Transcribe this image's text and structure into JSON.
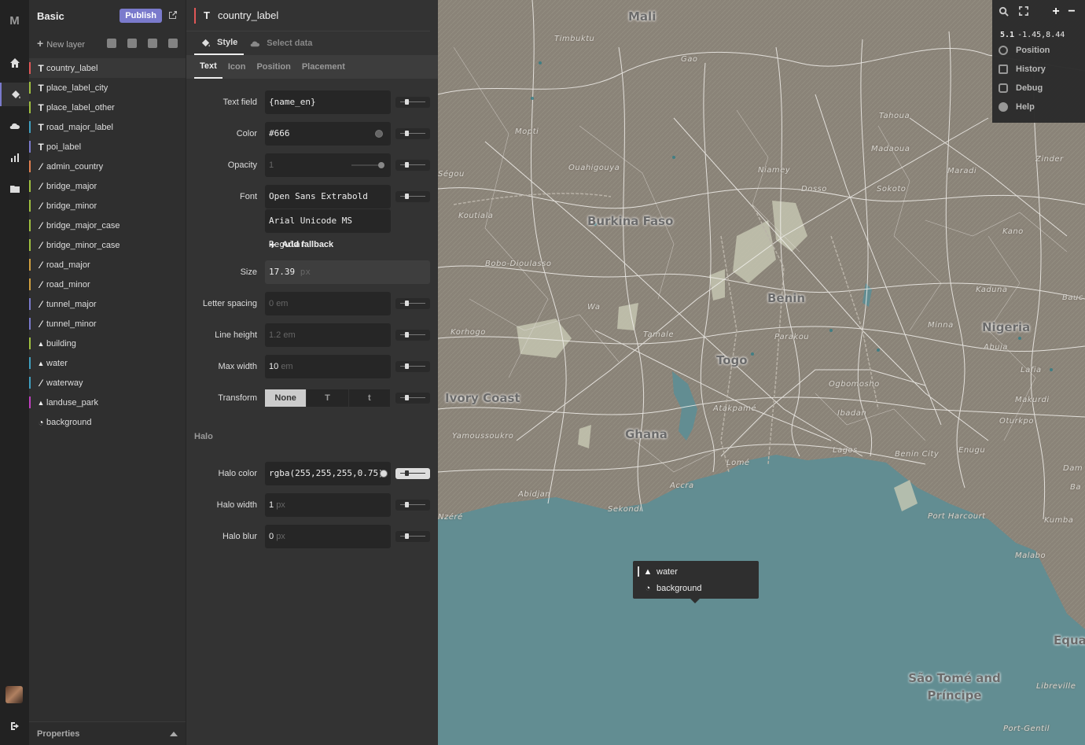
{
  "app": {
    "logo": "M"
  },
  "style": {
    "name": "Basic",
    "publish_label": "Publish"
  },
  "layer_tools": {
    "new_layer_label": "New layer"
  },
  "layers": [
    {
      "name": "country_label",
      "type": "T",
      "color": "#e05757",
      "selected": true
    },
    {
      "name": "place_label_city",
      "type": "T",
      "color": "#a0c040"
    },
    {
      "name": "place_label_other",
      "type": "T",
      "color": "#a0c040"
    },
    {
      "name": "road_major_label",
      "type": "T",
      "color": "#40a0c0"
    },
    {
      "name": "poi_label",
      "type": "T",
      "color": "#7a7acc"
    },
    {
      "name": "admin_country",
      "type": "line",
      "color": "#e08050"
    },
    {
      "name": "bridge_major",
      "type": "line",
      "color": "#a0c040"
    },
    {
      "name": "bridge_minor",
      "type": "line",
      "color": "#a0c040"
    },
    {
      "name": "bridge_major_case",
      "type": "line",
      "color": "#a0c040"
    },
    {
      "name": "bridge_minor_case",
      "type": "line",
      "color": "#a0c040"
    },
    {
      "name": "road_major",
      "type": "line",
      "color": "#d0a040"
    },
    {
      "name": "road_minor",
      "type": "line",
      "color": "#d0a040"
    },
    {
      "name": "tunnel_major",
      "type": "line",
      "color": "#7a7acc"
    },
    {
      "name": "tunnel_minor",
      "type": "line",
      "color": "#7a7acc"
    },
    {
      "name": "building",
      "type": "fill",
      "color": "#a0c040"
    },
    {
      "name": "water",
      "type": "fill",
      "color": "#40a0c0"
    },
    {
      "name": "waterway",
      "type": "line",
      "color": "#40a0c0"
    },
    {
      "name": "landuse_park",
      "type": "fill",
      "color": "#c040c0"
    },
    {
      "name": "background",
      "type": "background",
      "color": ""
    }
  ],
  "properties_label": "Properties",
  "editor": {
    "type_glyph": "T",
    "layer_name": "country_label",
    "modes": [
      "Style",
      "Select data"
    ],
    "tabs": [
      "Text",
      "Icon",
      "Position",
      "Placement"
    ],
    "fields": {
      "text_field": {
        "label": "Text field",
        "value": "{name_en}"
      },
      "color": {
        "label": "Color",
        "value": "#666"
      },
      "opacity": {
        "label": "Opacity",
        "value": "1"
      },
      "font": {
        "label": "Font",
        "value": "Open Sans Extrabold",
        "fallback": "Arial Unicode MS Regular",
        "add_fallback": "Add fallback"
      },
      "size": {
        "label": "Size",
        "value": "17.39",
        "unit": "px"
      },
      "letter_spacing": {
        "label": "Letter spacing",
        "value": "0",
        "unit": "em"
      },
      "line_height": {
        "label": "Line height",
        "value": "1.2",
        "unit": "em"
      },
      "max_width": {
        "label": "Max width",
        "value": "10",
        "unit": "em"
      },
      "transform": {
        "label": "Transform",
        "options": [
          "None",
          "T",
          "t"
        ],
        "selected": "None"
      }
    },
    "halo_section": "Halo",
    "halo": {
      "color": {
        "label": "Halo color",
        "value": "rgba(255,255,255,0.75)"
      },
      "width": {
        "label": "Halo width",
        "value": "1",
        "unit": "px"
      },
      "blur": {
        "label": "Halo blur",
        "value": "0",
        "unit": "px"
      }
    }
  },
  "map_controls": {
    "zoom": "5.1",
    "coords": "-1.45,8.44",
    "items": [
      "Position",
      "History",
      "Debug",
      "Help"
    ]
  },
  "popup": {
    "items": [
      "water",
      "background"
    ]
  },
  "map": {
    "countries": [
      "Mali",
      "Burkina Faso",
      "Benin",
      "Nigeria",
      "Togo",
      "Ivory Coast",
      "Ghana",
      "São Tomé and Príncipe",
      "Equato"
    ],
    "places": [
      "Timbuktu",
      "Gao",
      "Mopti",
      "Tahoua",
      "Ouahigouya",
      "Niamey",
      "Madaoua",
      "Maradi",
      "Zinder",
      "Dosso",
      "Sokoto",
      "Ségou",
      "Koutiala",
      "Kano",
      "Bobo-Dioulasso",
      "Wa",
      "Kaduna",
      "Bauc",
      "Korhogo",
      "Tamale",
      "Parakou",
      "Minna",
      "Abuja",
      "Lafia",
      "Atakpamé",
      "Ogbomosho",
      "Makurdi",
      "Ibadan",
      "Oturkpo",
      "Yamoussoukro",
      "Lomé",
      "Lagos",
      "Benin City",
      "Enugu",
      "Accra",
      "Abidjan",
      "Sekondi",
      "Port Harcourt",
      "Kumba",
      "Dam",
      "Ba",
      "Malabo",
      "Libreville",
      "Port-Gentil",
      "Nzéré"
    ]
  }
}
